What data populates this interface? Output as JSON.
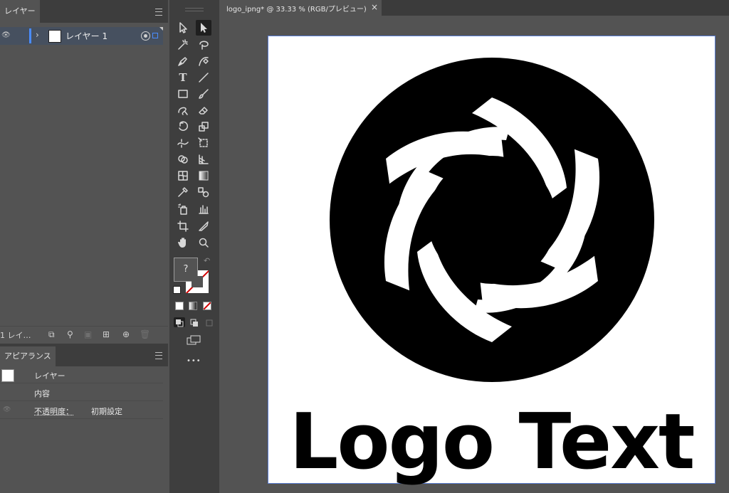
{
  "layers_panel": {
    "tab_label": "レイヤー",
    "layer_name": "レイヤー 1",
    "footer_count": "1 レイ…"
  },
  "appearance_panel": {
    "tab_label": "アピアランス",
    "row_layer": "レイヤー",
    "row_contents": "内容",
    "opacity_label": "不透明度：",
    "opacity_value": "初期設定"
  },
  "toolbar": {
    "fill_unknown": "?",
    "more": "•••"
  },
  "document": {
    "tab_title": "logo_ipng* @ 33.33 % (RGB/プレビュー)",
    "close_symbol": "×",
    "logo_text": "Logo Text"
  }
}
